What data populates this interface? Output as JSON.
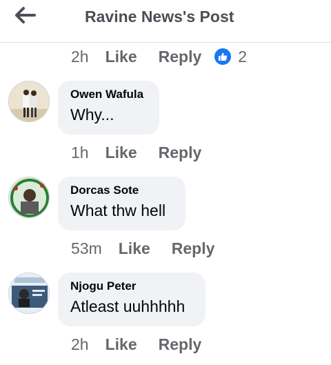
{
  "header": {
    "title": "Ravine News's Post"
  },
  "top_actions": {
    "time": "2h",
    "like": "Like",
    "reply": "Reply",
    "reaction_count": "2"
  },
  "comments": [
    {
      "author": "Owen Wafula",
      "text": "Why...",
      "time": "1h",
      "like": "Like",
      "reply": "Reply"
    },
    {
      "author": "Dorcas Sote",
      "text": "What thw hell",
      "time": "53m",
      "like": "Like",
      "reply": "Reply"
    },
    {
      "author": "Njogu Peter",
      "text": "Atleast uuhhhhh",
      "time": "2h",
      "like": "Like",
      "reply": "Reply"
    }
  ],
  "colors": {
    "accent": "#1877f2",
    "bubble": "#f0f2f5",
    "meta": "#65676b"
  },
  "icons": {
    "back": "arrow-left-icon",
    "reaction": "thumbs-up-icon"
  }
}
